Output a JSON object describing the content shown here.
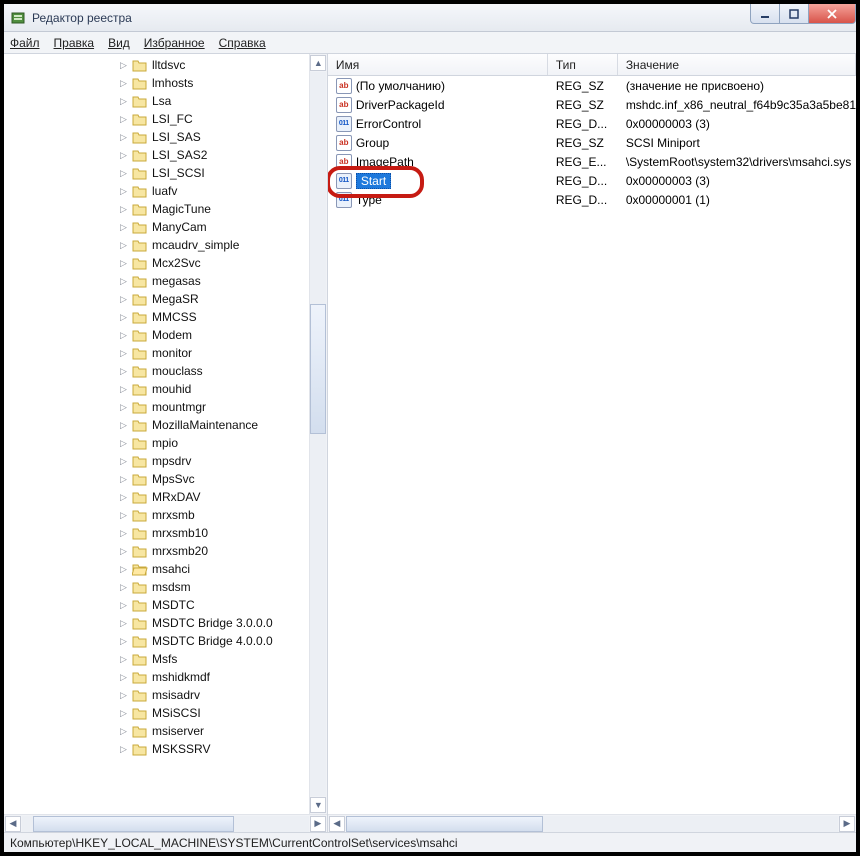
{
  "window": {
    "title": "Редактор реестра"
  },
  "menu": {
    "file": "Файл",
    "edit": "Правка",
    "view": "Вид",
    "favorites": "Избранное",
    "help": "Справка"
  },
  "tree": {
    "items": [
      "lltdsvc",
      "lmhosts",
      "Lsa",
      "LSI_FC",
      "LSI_SAS",
      "LSI_SAS2",
      "LSI_SCSI",
      "luafv",
      "MagicTune",
      "ManyCam",
      "mcaudrv_simple",
      "Mcx2Svc",
      "megasas",
      "MegaSR",
      "MMCSS",
      "Modem",
      "monitor",
      "mouclass",
      "mouhid",
      "mountmgr",
      "MozillaMaintenance",
      "mpio",
      "mpsdrv",
      "MpsSvc",
      "MRxDAV",
      "mrxsmb",
      "mrxsmb10",
      "mrxsmb20",
      "msahci",
      "msdsm",
      "MSDTC",
      "MSDTC Bridge 3.0.0.0",
      "MSDTC Bridge 4.0.0.0",
      "Msfs",
      "mshidkmdf",
      "msisadrv",
      "MSiSCSI",
      "msiserver",
      "MSKSSRV"
    ],
    "selected": "msahci"
  },
  "list": {
    "headers": {
      "name": "Имя",
      "type": "Тип",
      "value": "Значение"
    },
    "rows": [
      {
        "icon": "string",
        "name": "(По умолчанию)",
        "type": "REG_SZ",
        "value": "(значение не присвоено)"
      },
      {
        "icon": "string",
        "name": "DriverPackageId",
        "type": "REG_SZ",
        "value": "mshdc.inf_x86_neutral_f64b9c35a3a5be81"
      },
      {
        "icon": "dword",
        "name": "ErrorControl",
        "type": "REG_D...",
        "value": "0x00000003 (3)"
      },
      {
        "icon": "string",
        "name": "Group",
        "type": "REG_SZ",
        "value": "SCSI Miniport"
      },
      {
        "icon": "string",
        "name": "ImagePath",
        "type": "REG_E...",
        "value": "\\SystemRoot\\system32\\drivers\\msahci.sys"
      },
      {
        "icon": "dword",
        "name": "Start",
        "type": "REG_D...",
        "value": "0x00000003 (3)",
        "selected": true
      },
      {
        "icon": "dword",
        "name": "Type",
        "type": "REG_D...",
        "value": "0x00000001 (1)"
      }
    ]
  },
  "statusbar": {
    "path": "Компьютер\\HKEY_LOCAL_MACHINE\\SYSTEM\\CurrentControlSet\\services\\msahci"
  }
}
